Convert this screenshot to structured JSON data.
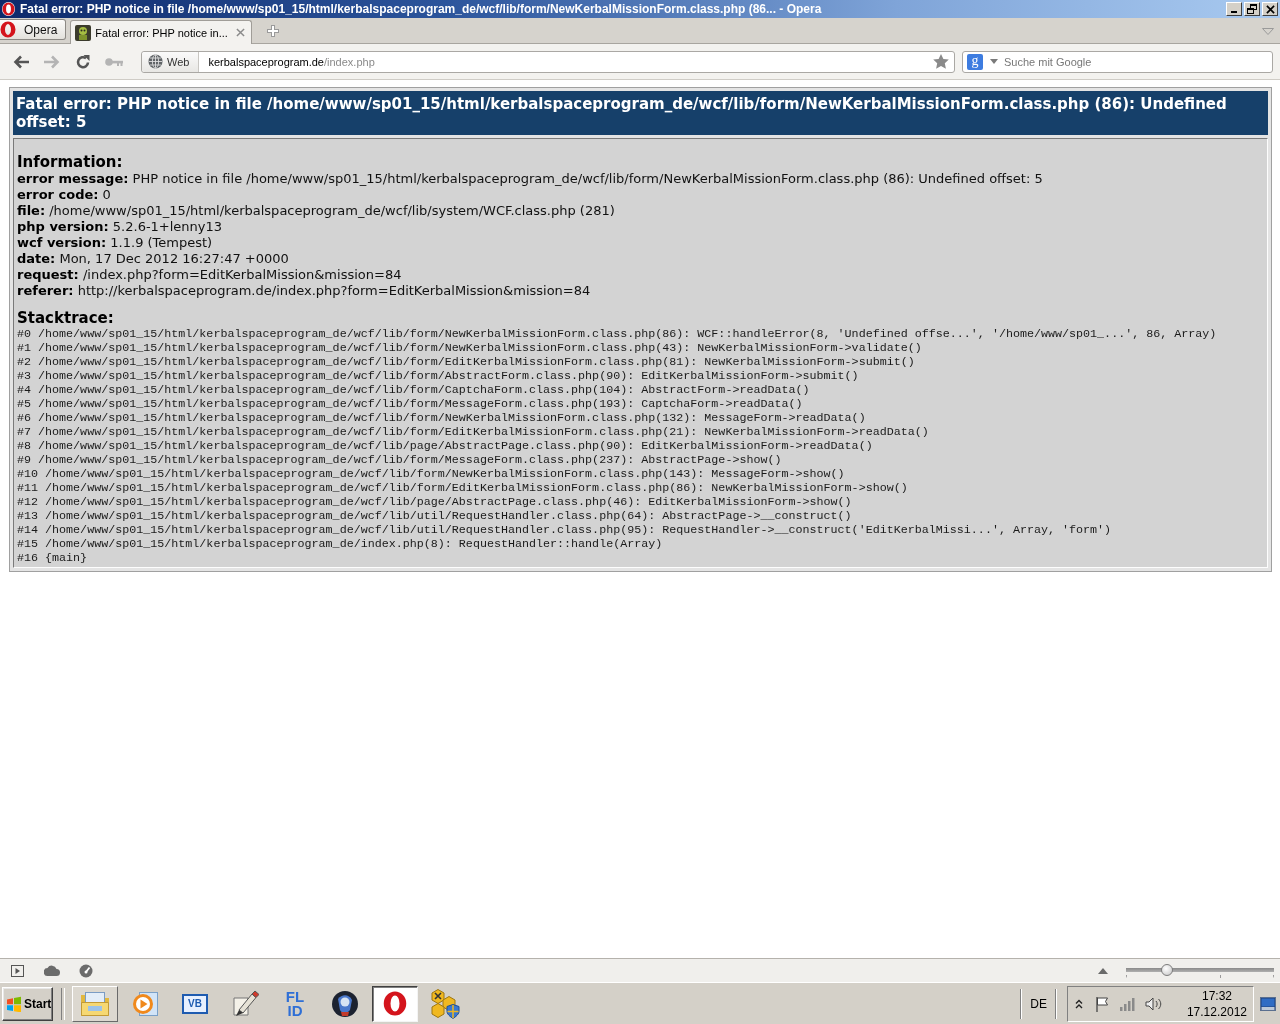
{
  "window": {
    "title": "Fatal error: PHP notice in file /home/www/sp01_15/html/kerbalspaceprogram_de/wcf/lib/form/NewKerbalMissionForm.class.php (86... - Opera"
  },
  "menu_button": {
    "label": "Opera"
  },
  "tabs": [
    {
      "label": "Fatal error: PHP notice in...",
      "selected": true
    }
  ],
  "toolbar": {
    "buttons": [
      {
        "kind": "back",
        "disabled": false
      },
      {
        "kind": "forward",
        "disabled": true
      },
      {
        "kind": "reload",
        "disabled": false
      },
      {
        "kind": "key",
        "disabled": true
      }
    ]
  },
  "address_bar": {
    "badge": "Web",
    "host": "kerbalspaceprogram.de",
    "path": "/index.php"
  },
  "search": {
    "engine_letter": "g",
    "placeholder": "Suche mit Google"
  },
  "error_page": {
    "title": "Fatal error: PHP notice in file /home/www/sp01_15/html/kerbalspaceprogram_de/wcf/lib/form/NewKerbalMissionForm.class.php (86): Undefined offset: 5",
    "information": {
      "heading": "Information:",
      "lines": [
        "**error message:** PHP notice in file /home/www/sp01_15/html/kerbalspaceprogram_de/wcf/lib/form/NewKerbalMissionForm.class.php (86): Undefined offset: 5",
        "**error code:** 0",
        "**file:** /home/www/sp01_15/html/kerbalspaceprogram_de/wcf/lib/system/WCF.class.php (281)",
        "**php version:** 5.2.6-1+lenny13",
        "**wcf version:** 1.1.9 (Tempest)",
        "**date:** Mon, 17 Dec 2012 16:27:47 +0000",
        "**request:** /index.php?form=EditKerbalMission&mission=84",
        "**referer:** http://kerbalspaceprogram.de/index.php?form=EditKerbalMission&mission=84"
      ]
    },
    "stacktrace": {
      "heading": "Stacktrace:",
      "lines": [
        "#0 /home/www/sp01_15/html/kerbalspaceprogram_de/wcf/lib/form/NewKerbalMissionForm.class.php(86): WCF::handleError(8, 'Undefined offse...', '/home/www/sp01_...', 86, Array)",
        "#1 /home/www/sp01_15/html/kerbalspaceprogram_de/wcf/lib/form/NewKerbalMissionForm.class.php(43): NewKerbalMissionForm->validate()",
        "#2 /home/www/sp01_15/html/kerbalspaceprogram_de/wcf/lib/form/EditKerbalMissionForm.class.php(81): NewKerbalMissionForm->submit()",
        "#3 /home/www/sp01_15/html/kerbalspaceprogram_de/wcf/lib/form/AbstractForm.class.php(90): EditKerbalMissionForm->submit()",
        "#4 /home/www/sp01_15/html/kerbalspaceprogram_de/wcf/lib/form/CaptchaForm.class.php(104): AbstractForm->readData()",
        "#5 /home/www/sp01_15/html/kerbalspaceprogram_de/wcf/lib/form/MessageForm.class.php(193): CaptchaForm->readData()",
        "#6 /home/www/sp01_15/html/kerbalspaceprogram_de/wcf/lib/form/NewKerbalMissionForm.class.php(132): MessageForm->readData()",
        "#7 /home/www/sp01_15/html/kerbalspaceprogram_de/wcf/lib/form/EditKerbalMissionForm.class.php(21): NewKerbalMissionForm->readData()",
        "#8 /home/www/sp01_15/html/kerbalspaceprogram_de/wcf/lib/page/AbstractPage.class.php(90): EditKerbalMissionForm->readData()",
        "#9 /home/www/sp01_15/html/kerbalspaceprogram_de/wcf/lib/form/MessageForm.class.php(237): AbstractPage->show()",
        "#10 /home/www/sp01_15/html/kerbalspaceprogram_de/wcf/lib/form/NewKerbalMissionForm.class.php(143): MessageForm->show()",
        "#11 /home/www/sp01_15/html/kerbalspaceprogram_de/wcf/lib/form/EditKerbalMissionForm.class.php(86): NewKerbalMissionForm->show()",
        "#12 /home/www/sp01_15/html/kerbalspaceprogram_de/wcf/lib/page/AbstractPage.class.php(46): EditKerbalMissionForm->show()",
        "#13 /home/www/sp01_15/html/kerbalspaceprogram_de/wcf/lib/util/RequestHandler.class.php(64): AbstractPage->__construct()",
        "#14 /home/www/sp01_15/html/kerbalspaceprogram_de/wcf/lib/util/RequestHandler.class.php(95): RequestHandler->__construct('EditKerbalMissi...', Array, 'form')",
        "#15 /home/www/sp01_15/html/kerbalspaceprogram_de/index.php(8): RequestHandler::handle(Array)",
        "#16 {main}"
      ]
    }
  },
  "status_bar": {
    "zoom_slider": {
      "level": 0.28
    }
  },
  "taskbar": {
    "start": "Start",
    "apps": [
      {
        "kind": "folder",
        "running": true,
        "selected": false
      },
      {
        "kind": "media-player",
        "running": false,
        "selected": false
      },
      {
        "kind": "vb-window",
        "label": "VB",
        "running": false,
        "selected": false
      },
      {
        "kind": "paint",
        "running": false,
        "selected": false
      },
      {
        "kind": "lettering",
        "label": "FL ID",
        "running": false,
        "selected": false
      },
      {
        "kind": "game",
        "running": false,
        "selected": false
      },
      {
        "kind": "opera",
        "running": true,
        "selected": true
      },
      {
        "kind": "hexagons",
        "running": false,
        "selected": false
      }
    ],
    "language": "DE",
    "clock": {
      "time": "17:32",
      "date": "17.12.2012"
    }
  }
}
